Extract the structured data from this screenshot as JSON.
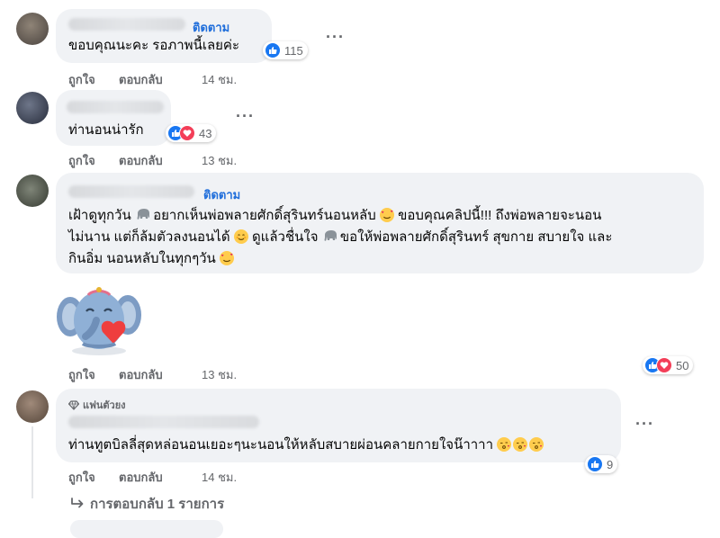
{
  "comments": [
    {
      "follow": "ติดตาม",
      "text": "ขอบคุณนะคะ รอภาพนี้เลยค่ะ",
      "reaction_count": "115",
      "like": "ถูกใจ",
      "reply": "ตอบกลับ",
      "time": "14 ชม."
    },
    {
      "text": "ท่านอนน่ารัก",
      "reaction_count": "43",
      "like": "ถูกใจ",
      "reply": "ตอบกลับ",
      "time": "13 ชม."
    },
    {
      "follow": "ติดตาม",
      "line1": "เฝ้าดูทุกวัน",
      "line1b": "อยากเห็นพ่อพลายศักดิ์สุรินทร์นอนหลับ",
      "line1c": "ขอบคุณคลิปนี้!!! ถึงพ่อพลายจะนอน",
      "line2": "ไม่นาน แต่ก็ล้มตัวลงนอนได้",
      "line2b": "ดูแล้วชื่นใจ",
      "line2c": "ขอให้พ่อพลายศักดิ์สุรินทร์ สุขกาย สบายใจ และ",
      "line3": "กินอิ่ม นอนหลับในทุกๆวัน",
      "like": "ถูกใจ",
      "reply": "ตอบกลับ",
      "time": "13 ชม.",
      "reaction_count": "50"
    },
    {
      "badge": "แฟนตัวยง",
      "text": "ท่านทูตบิลลี่สุดหล่อนอนเยอะๆนะนอนให้หลับสบายผ่อนคลายกายใจน๊าาาา",
      "reaction_count": "9",
      "like": "ถูกใจ",
      "reply": "ตอบกลับ",
      "time": "14 ชม.",
      "view_replies": "การตอบกลับ 1 รายการ"
    }
  ],
  "icons": {
    "like": "thumbs-up-icon",
    "love": "heart-icon",
    "more": "more-options-icon",
    "reply_arrow": "reply-arrow-icon",
    "fan_badge": "diamond-badge-icon",
    "elephant": "elephant-emoji",
    "smiling_hearts": "smiling-face-with-hearts-emoji",
    "kissing": "face-blowing-kiss-emoji",
    "relieved": "smiling-face-emoji"
  },
  "colors": {
    "bubble": "#f0f2f5",
    "follow": "#216fdb",
    "secondary_text": "#65676b",
    "like_blue": "#1877f2",
    "love_red": "#f33e58"
  }
}
